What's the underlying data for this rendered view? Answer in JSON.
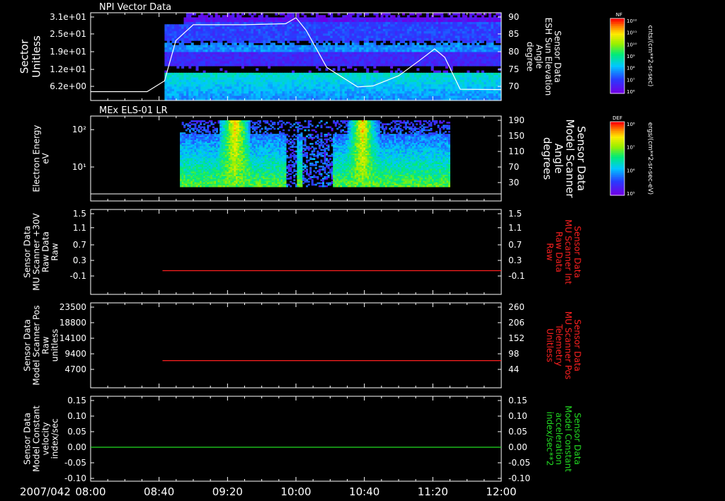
{
  "chart_data": [
    {
      "type": "heatmap",
      "title": "NPI Vector Data",
      "ylabel": [
        "Sector",
        "Unitless"
      ],
      "yticks": [
        "3.1e+01",
        "2.5e+01",
        "1.9e+01",
        "1.2e+01",
        "6.2e+00"
      ],
      "y2label": [
        "Sensor Data",
        "ESH Sun Elevation",
        "Angle",
        "degree"
      ],
      "y2ticks": [
        "90",
        "85",
        "80",
        "75",
        "70"
      ],
      "y2lim": [
        66,
        90
      ],
      "colorbar": {
        "tag": "NF",
        "top": "10¹²",
        "bottom": "10⁶",
        "ticks": [
          "10¹²",
          "10¹¹",
          "10¹⁰",
          "10⁹",
          "10⁸",
          "10⁷",
          "10⁶"
        ],
        "label": "cnts/(cm**2-sr-sec)"
      },
      "overlay_line": {
        "color": "#ffffff",
        "t": [
          8.0,
          8.55,
          8.72,
          8.83,
          9.0,
          9.5,
          9.9,
          10.0,
          10.1,
          10.3,
          10.6,
          10.75,
          11.0,
          11.2,
          11.35,
          11.45,
          11.6,
          12.0
        ],
        "y": [
          67.8,
          67.8,
          71.0,
          83.0,
          87.7,
          87.7,
          88.0,
          89.8,
          86.0,
          75.0,
          69.2,
          69.5,
          72.5,
          77.0,
          80.5,
          78.0,
          68.5,
          68.4
        ]
      }
    },
    {
      "type": "heatmap",
      "title": "MEx ELS-01 LR",
      "ylabel": [
        "Electron Energy",
        "eV"
      ],
      "yticks": [
        "10²",
        "10¹"
      ],
      "y2label": [
        "Sensor Data",
        "Model Scanner",
        "Angle",
        "degrees"
      ],
      "y2ticks": [
        "190",
        "150",
        "110",
        "70",
        "30"
      ],
      "colorbar": {
        "tag": "DEF",
        "top": "10⁸",
        "bottom": "10⁵",
        "ticks": [
          "10⁸",
          "10⁷",
          "10⁶",
          "10⁵"
        ],
        "label": "ergs/(cm**2-sr-sec-eV)"
      },
      "overlay_line": {
        "color": "#ffffff",
        "t": [
          8.0,
          12.0
        ],
        "y": [
          10,
          10
        ]
      }
    },
    {
      "type": "line",
      "ylabel": [
        "Sensor Data",
        "MU Scanner +30V",
        "Raw Data",
        "Raw"
      ],
      "yticks": [
        "1.5",
        "1.1",
        "0.7",
        "0.3",
        "-0.1"
      ],
      "y2label": [
        "Sensor Data",
        "MU Scanner Int",
        "Raw Data",
        "Raw"
      ],
      "y2ticks": [
        "1.5",
        "1.1",
        "0.7",
        "0.3",
        "-0.1"
      ],
      "ylim": [
        -0.5,
        1.5
      ],
      "series": [
        {
          "color": "#ff2020",
          "t": [
            8.7,
            12.0
          ],
          "y": [
            0.0,
            0.0
          ]
        }
      ]
    },
    {
      "type": "line",
      "ylabel": [
        "Sensor Data",
        "Model Scanner Pos",
        "Raw",
        "unitless"
      ],
      "yticks": [
        "23500",
        "18800",
        "14100",
        "9400",
        "4700"
      ],
      "y2label": [
        "Sensor Data",
        "MU Scanner Pos",
        "Telemetry",
        "Unitless"
      ],
      "y2ticks": [
        "260",
        "206",
        "152",
        "98",
        "44"
      ],
      "ylim": [
        0,
        23500
      ],
      "series": [
        {
          "color": "#ff2020",
          "t": [
            8.7,
            12.0
          ],
          "y": [
            8200,
            8200
          ]
        }
      ]
    },
    {
      "type": "line",
      "ylabel": [
        "Sensor Data",
        "Model Constant",
        "velocity",
        "index/sec"
      ],
      "yticks": [
        "0.15",
        "0.10",
        "0.05",
        "0.00",
        "-0.05",
        "-0.10"
      ],
      "y2label": [
        "Sensor Data",
        "Model Constant",
        "acceleration",
        "index/sec**2"
      ],
      "y2ticks": [
        "0.15",
        "0.10",
        "0.05",
        "0.00",
        "-0.05",
        "-0.10"
      ],
      "ylim": [
        -0.1,
        0.15
      ],
      "series": [
        {
          "color": "#22dd22",
          "t": [
            8.0,
            12.0
          ],
          "y": [
            0.0,
            0.0
          ]
        }
      ]
    }
  ],
  "xaxis": {
    "date": "2007/042",
    "ticks": [
      "08:00",
      "08:40",
      "09:20",
      "10:00",
      "10:40",
      "11:20",
      "12:00"
    ],
    "tick_hours": [
      8.0,
      8.6667,
      9.3333,
      10.0,
      10.6667,
      11.3333,
      12.0
    ],
    "range_hours": [
      8.0,
      12.0
    ]
  }
}
